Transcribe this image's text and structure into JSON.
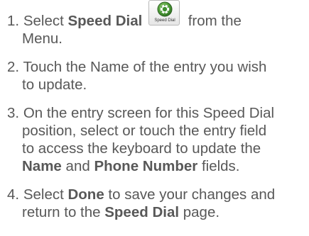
{
  "steps": [
    {
      "number": "1.",
      "pre": "Select ",
      "bold1": "Speed Dial",
      "icon_label": "Speed Dial",
      "post": "from the",
      "line2": "Menu."
    },
    {
      "number": "2.",
      "line1": "Touch the Name of the entry you wish",
      "line2": "to update."
    },
    {
      "number": "3.",
      "line1": "On the entry screen for this Speed Dial",
      "line2": "position, select or touch the entry field",
      "line3": "to access the keyboard to update the",
      "bold_name": "Name",
      "and": " and ",
      "bold_phone": "Phone Number",
      "fields": " fields."
    },
    {
      "number": "4.",
      "pre": "Select ",
      "bold_done": "Done",
      "post": " to save your changes and",
      "line2_pre": "return to the ",
      "bold_sd": "Speed Dial",
      "line2_post": " page."
    }
  ],
  "colors": {
    "text": "#585858",
    "icon_green": "#3f8f2f"
  },
  "icon": "speed-dial-icon"
}
